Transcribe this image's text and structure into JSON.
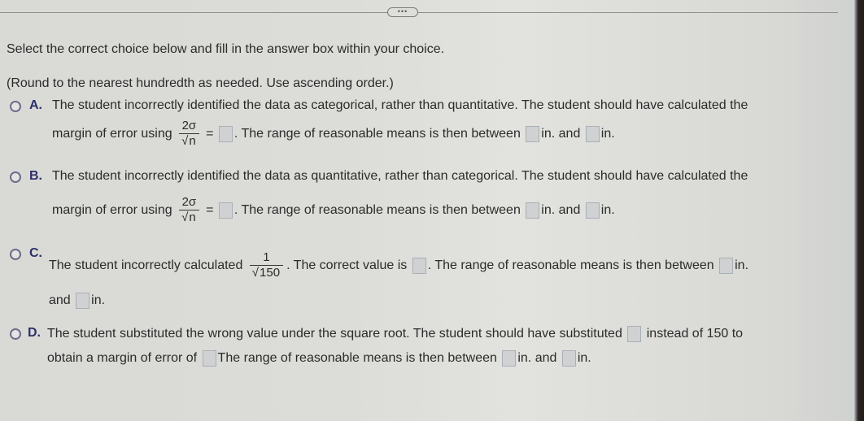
{
  "more_button": {
    "label": "•••"
  },
  "instructions": {
    "line1": "Select the correct choice below and fill in the answer box within your choice.",
    "line2": "(Round to the nearest hundredth as needed. Use ascending order.)"
  },
  "choices": [
    {
      "letter": "A.",
      "line1": "The student incorrectly identified the data as categorical, rather than quantitative. The student should have calculated the",
      "pre_formula": "margin of error using",
      "formula_num": "2σ",
      "formula_den_radicand": "n",
      "equals": "=",
      "after_box": ". The range of reasonable means is then between",
      "unit1": "in. and",
      "unit2": "in."
    },
    {
      "letter": "B.",
      "line1": "The student incorrectly identified the data as quantitative, rather than categorical. The student should have calculated the",
      "pre_formula": "margin of error using",
      "formula_num": "2σ",
      "formula_den_radicand": "n",
      "equals": "=",
      "after_box": ". The range of reasonable means is then between",
      "unit1": "in. and",
      "unit2": "in."
    },
    {
      "letter": "C.",
      "pre_formula": "The student incorrectly calculated",
      "formula_num": "1",
      "formula_den_radicand": "150",
      "after_formula": ". The correct value is",
      "after_box": ". The range of reasonable means is then between",
      "unit1": "in.",
      "line2_pre": "and",
      "unit2": "in."
    },
    {
      "letter": "D.",
      "line1_pre": "The student substituted the wrong value under the square root. The student should have substituted",
      "line1_post": "instead of 150 to",
      "line2_pre": "obtain a margin of error of",
      "line2_mid": "The range of reasonable means is then between",
      "unit1": "in. and",
      "unit2": "in."
    }
  ]
}
